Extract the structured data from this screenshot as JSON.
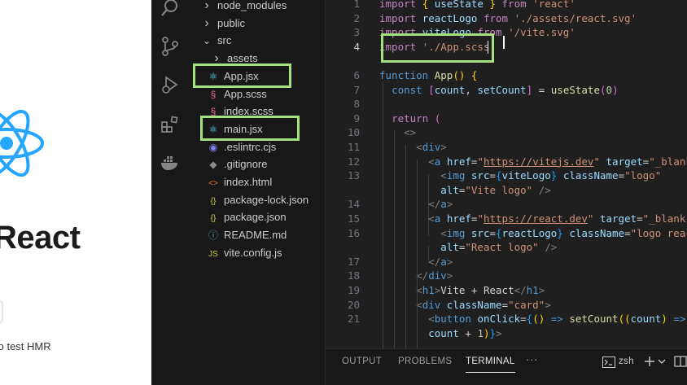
{
  "preview": {
    "title": "React",
    "hint": "to test HMR"
  },
  "colors": {
    "highlight_box": "#a4e07e",
    "react_logo": "#26a5ff",
    "editor_bg": "#1f1f1f",
    "sidebar_bg": "#181818"
  },
  "activity_bar": {
    "icons": [
      "search-icon",
      "source-control-icon",
      "run-debug-icon",
      "extensions-icon",
      "docker-icon"
    ]
  },
  "explorer": {
    "items": [
      {
        "label": "node_modules",
        "icon": "chevron-right-icon",
        "kind": "folder"
      },
      {
        "label": "public",
        "icon": "chevron-right-icon",
        "kind": "folder"
      },
      {
        "label": "src",
        "icon": "chevron-down-icon",
        "kind": "folder"
      },
      {
        "label": "assets",
        "icon": "chevron-right-icon",
        "kind": "folder"
      },
      {
        "label": "App.jsx",
        "icon": "react-icon",
        "kind": "file"
      },
      {
        "label": "App.scss",
        "icon": "sass-icon",
        "kind": "file"
      },
      {
        "label": "index.scss",
        "icon": "sass-icon",
        "kind": "file"
      },
      {
        "label": "main.jsx",
        "icon": "react-icon",
        "kind": "file"
      },
      {
        "label": ".eslintrc.cjs",
        "icon": "eslint-icon",
        "kind": "file"
      },
      {
        "label": ".gitignore",
        "icon": "git-icon",
        "kind": "file"
      },
      {
        "label": "index.html",
        "icon": "html-icon",
        "kind": "file"
      },
      {
        "label": "package-lock.json",
        "icon": "json-icon",
        "kind": "file"
      },
      {
        "label": "package.json",
        "icon": "json-icon",
        "kind": "file"
      },
      {
        "label": "README.md",
        "icon": "info-icon",
        "kind": "file"
      },
      {
        "label": "vite.config.js",
        "icon": "js-icon",
        "kind": "file"
      }
    ]
  },
  "code": {
    "active_line": "4",
    "lines": [
      {
        "num": "1",
        "tokens": [
          [
            "k",
            "import "
          ],
          [
            "br1",
            "{ "
          ],
          [
            "v",
            "useState"
          ],
          [
            "br1",
            " } "
          ],
          [
            "k",
            "from "
          ],
          [
            "s",
            "'react'"
          ]
        ]
      },
      {
        "num": "2",
        "tokens": [
          [
            "k",
            "import "
          ],
          [
            "v",
            "reactLogo "
          ],
          [
            "k",
            "from "
          ],
          [
            "s",
            "'./assets/react.svg'"
          ]
        ]
      },
      {
        "num": "3",
        "tokens": [
          [
            "k",
            "import "
          ],
          [
            "v",
            "viteLogo "
          ],
          [
            "k",
            "from "
          ],
          [
            "s",
            "'/vite.svg'"
          ]
        ]
      },
      {
        "num": "4",
        "tokens": [
          [
            "k",
            "import "
          ],
          [
            "s",
            "'./App.scss'"
          ]
        ]
      },
      {
        "num": "",
        "tokens": []
      },
      {
        "num": "6",
        "tokens": [
          [
            "kb",
            "function "
          ],
          [
            "f",
            "App"
          ],
          [
            "br1",
            "() {"
          ]
        ]
      },
      {
        "num": "7",
        "tokens": [
          [
            "d",
            "  "
          ],
          [
            "kb",
            "const "
          ],
          [
            "br2",
            "["
          ],
          [
            "v",
            "count"
          ],
          [
            "d",
            ", "
          ],
          [
            "v",
            "setCount"
          ],
          [
            "br2",
            "]"
          ],
          [
            "d",
            " = "
          ],
          [
            "f",
            "useState"
          ],
          [
            "br2",
            "("
          ],
          [
            "n",
            "0"
          ],
          [
            "br2",
            ")"
          ]
        ]
      },
      {
        "num": "8",
        "tokens": []
      },
      {
        "num": "9",
        "tokens": [
          [
            "d",
            "  "
          ],
          [
            "k",
            "return "
          ],
          [
            "br2",
            "("
          ]
        ]
      },
      {
        "num": "10",
        "tokens": [
          [
            "d",
            "    "
          ],
          [
            "p",
            "<>"
          ]
        ]
      },
      {
        "num": "11",
        "tokens": [
          [
            "d",
            "      "
          ],
          [
            "p",
            "<"
          ],
          [
            "tg",
            "div"
          ],
          [
            "p",
            ">"
          ]
        ]
      },
      {
        "num": "12",
        "tokens": [
          [
            "d",
            "        "
          ],
          [
            "p",
            "<"
          ],
          [
            "tg",
            "a "
          ],
          [
            "a",
            "href"
          ],
          [
            "d",
            "="
          ],
          [
            "s",
            "\""
          ],
          [
            "su",
            "https://vitejs.dev"
          ],
          [
            "s",
            "\" "
          ],
          [
            "a",
            "target"
          ],
          [
            "d",
            "="
          ],
          [
            "s",
            "\"_blank\""
          ],
          [
            "p",
            ">"
          ]
        ]
      },
      {
        "num": "13",
        "tokens": [
          [
            "d",
            "          "
          ],
          [
            "p",
            "<"
          ],
          [
            "tg",
            "img "
          ],
          [
            "a",
            "src"
          ],
          [
            "d",
            "="
          ],
          [
            "br3",
            "{"
          ],
          [
            "v",
            "viteLogo"
          ],
          [
            "br3",
            "} "
          ],
          [
            "a",
            "className"
          ],
          [
            "d",
            "="
          ],
          [
            "s",
            "\"logo\""
          ]
        ]
      },
      {
        "num": "",
        "tokens": [
          [
            "d",
            "          "
          ],
          [
            "a",
            "alt"
          ],
          [
            "d",
            "="
          ],
          [
            "s",
            "\"Vite logo\" "
          ],
          [
            "p",
            "/>"
          ]
        ]
      },
      {
        "num": "14",
        "tokens": [
          [
            "d",
            "        "
          ],
          [
            "p",
            "</"
          ],
          [
            "tg",
            "a"
          ],
          [
            "p",
            ">"
          ]
        ]
      },
      {
        "num": "15",
        "tokens": [
          [
            "d",
            "        "
          ],
          [
            "p",
            "<"
          ],
          [
            "tg",
            "a "
          ],
          [
            "a",
            "href"
          ],
          [
            "d",
            "="
          ],
          [
            "s",
            "\""
          ],
          [
            "su",
            "https://react.dev"
          ],
          [
            "s",
            "\" "
          ],
          [
            "a",
            "target"
          ],
          [
            "d",
            "="
          ],
          [
            "s",
            "\"_blank\""
          ],
          [
            "p",
            ">"
          ]
        ]
      },
      {
        "num": "16",
        "tokens": [
          [
            "d",
            "          "
          ],
          [
            "p",
            "<"
          ],
          [
            "tg",
            "img "
          ],
          [
            "a",
            "src"
          ],
          [
            "d",
            "="
          ],
          [
            "br3",
            "{"
          ],
          [
            "v",
            "reactLogo"
          ],
          [
            "br3",
            "} "
          ],
          [
            "a",
            "className"
          ],
          [
            "d",
            "="
          ],
          [
            "s",
            "\"logo react\""
          ]
        ]
      },
      {
        "num": "",
        "tokens": [
          [
            "d",
            "          "
          ],
          [
            "a",
            "alt"
          ],
          [
            "d",
            "="
          ],
          [
            "s",
            "\"React logo\" "
          ],
          [
            "p",
            "/>"
          ]
        ]
      },
      {
        "num": "17",
        "tokens": [
          [
            "d",
            "        "
          ],
          [
            "p",
            "</"
          ],
          [
            "tg",
            "a"
          ],
          [
            "p",
            ">"
          ]
        ]
      },
      {
        "num": "18",
        "tokens": [
          [
            "d",
            "      "
          ],
          [
            "p",
            "</"
          ],
          [
            "tg",
            "div"
          ],
          [
            "p",
            ">"
          ]
        ]
      },
      {
        "num": "19",
        "tokens": [
          [
            "d",
            "      "
          ],
          [
            "p",
            "<"
          ],
          [
            "tg",
            "h1"
          ],
          [
            "p",
            ">"
          ],
          [
            "d",
            "Vite + React"
          ],
          [
            "p",
            "</"
          ],
          [
            "tg",
            "h1"
          ],
          [
            "p",
            ">"
          ]
        ]
      },
      {
        "num": "20",
        "tokens": [
          [
            "d",
            "      "
          ],
          [
            "p",
            "<"
          ],
          [
            "tg",
            "div "
          ],
          [
            "a",
            "className"
          ],
          [
            "d",
            "="
          ],
          [
            "s",
            "\"card\""
          ],
          [
            "p",
            ">"
          ]
        ]
      },
      {
        "num": "21",
        "tokens": [
          [
            "d",
            "        "
          ],
          [
            "p",
            "<"
          ],
          [
            "tg",
            "button "
          ],
          [
            "a",
            "onClick"
          ],
          [
            "d",
            "="
          ],
          [
            "br3",
            "{"
          ],
          [
            "br1",
            "() "
          ],
          [
            "kb",
            "=> "
          ],
          [
            "f",
            "setCount"
          ],
          [
            "br1",
            "(("
          ],
          [
            "v",
            "count"
          ],
          [
            "br1",
            ") "
          ],
          [
            "kb",
            "=>"
          ]
        ]
      },
      {
        "num": "",
        "tokens": [
          [
            "d",
            "        "
          ],
          [
            "v",
            "count "
          ],
          [
            "d",
            "+ "
          ],
          [
            "n",
            "1"
          ],
          [
            "br1",
            ")"
          ],
          [
            "br3",
            "}"
          ],
          [
            "p",
            ">"
          ]
        ]
      }
    ]
  },
  "panel": {
    "tabs": [
      {
        "label": "OUTPUT",
        "active": false
      },
      {
        "label": "PROBLEMS",
        "active": false
      },
      {
        "label": "TERMINAL",
        "active": true
      }
    ],
    "more": "···",
    "shell": "zsh"
  }
}
